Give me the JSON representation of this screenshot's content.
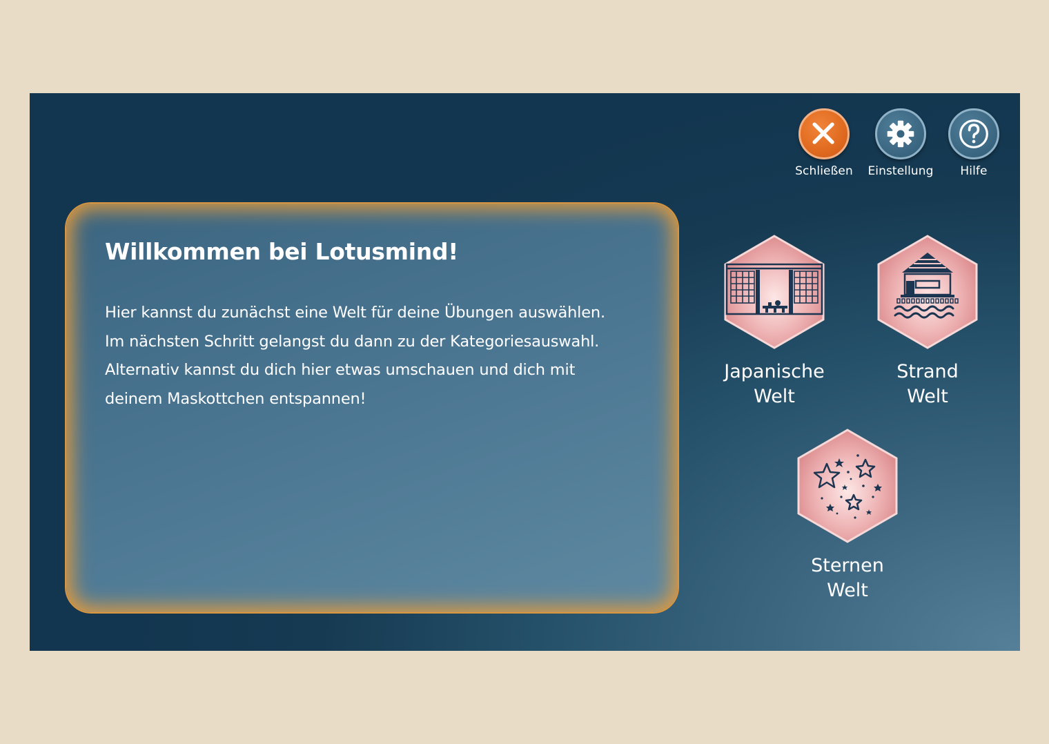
{
  "header": {
    "actions": [
      {
        "id": "close",
        "label": "Schließen",
        "icon": "close-icon",
        "color": "#e06a1f"
      },
      {
        "id": "settings",
        "label": "Einstellung",
        "icon": "gear-icon",
        "color": "#3a6580"
      },
      {
        "id": "help",
        "label": "Hilfe",
        "icon": "question-mark-icon",
        "color": "#3a6580"
      }
    ]
  },
  "welcome": {
    "title": "Willkommen bei Lotusmind!",
    "lines": [
      "Hier kannst du zunächst eine Welt für deine Übungen auswählen.",
      "Im nächsten Schritt gelangst du dann zu der Kategoriesauswahl.",
      "Alternativ kannst du dich hier etwas umschauen und dich mit",
      "deinem Maskottchen entspannen!"
    ]
  },
  "worlds": [
    {
      "id": "japanese",
      "line1": "Japanische",
      "line2": "Welt",
      "icon": "japanese-room-icon"
    },
    {
      "id": "beach",
      "line1": "Strand",
      "line2": "Welt",
      "icon": "beach-hut-icon"
    },
    {
      "id": "stars",
      "line1": "Sternen",
      "line2": "Welt",
      "icon": "stars-icon"
    }
  ],
  "colors": {
    "background": "#e9dcc7",
    "screen": "#163a52",
    "panel_glow": "#e09a3e",
    "hex_fill": "#e8a3a6",
    "icon_stroke": "#1c3550"
  }
}
